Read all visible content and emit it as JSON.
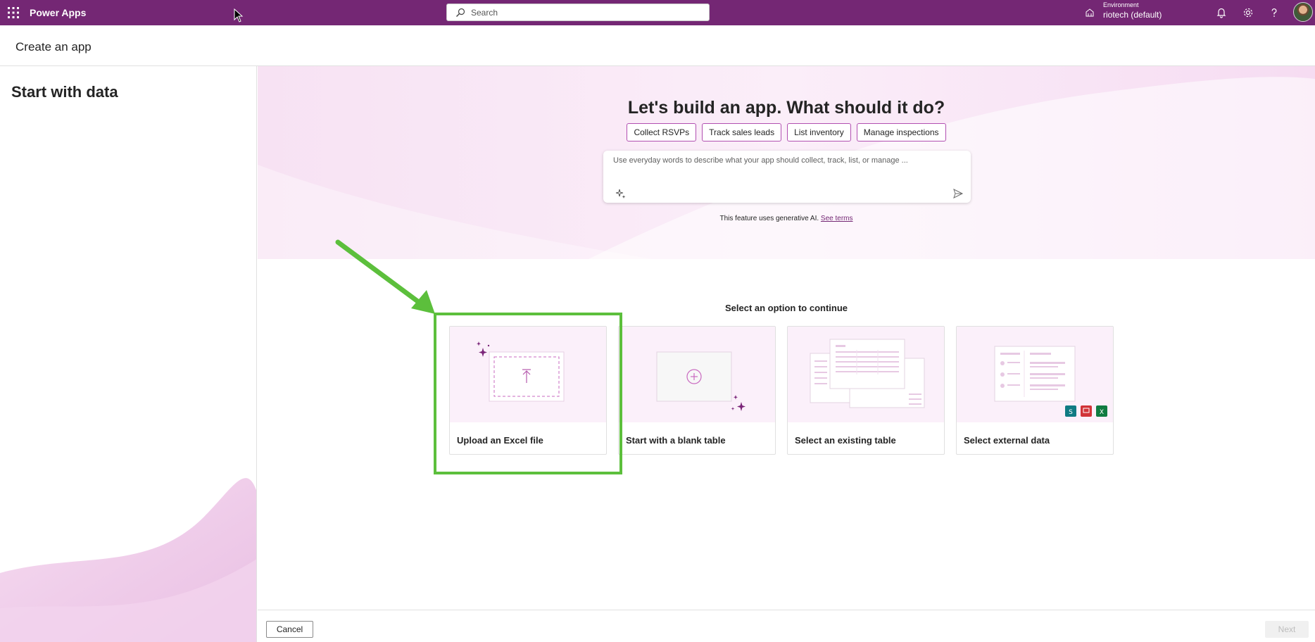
{
  "topbar": {
    "app_name": "Power Apps",
    "search_placeholder": "Search",
    "environment_label": "Environment",
    "environment_name": "riotech (default)",
    "icons": [
      "waffle-icon",
      "environment-icon",
      "bell-icon",
      "gear-icon",
      "help-icon"
    ],
    "brand_color": "#742774"
  },
  "header": {
    "title": "Create an app"
  },
  "left_pane": {
    "heading": "Start with data"
  },
  "hero": {
    "title": "Let's build an app. What should it do?",
    "suggestions": [
      "Collect RSVPs",
      "Track sales leads",
      "List inventory",
      "Manage inspections"
    ],
    "prompt_placeholder": "Use everyday words to describe what your app should collect, track, list, or manage ...",
    "ai_note": "This feature uses generative AI.",
    "see_terms": "See terms"
  },
  "options": {
    "label": "Select an option to continue",
    "cards": [
      {
        "label": "Upload an Excel file",
        "icon": "upload-icon"
      },
      {
        "label": "Start with a blank table",
        "icon": "plus-circle-icon"
      },
      {
        "label": "Select an existing table",
        "icon": "table-icon"
      },
      {
        "label": "Select external data",
        "icon": "external-data-icon"
      }
    ],
    "highlight_color": "#5cbf3c"
  },
  "footer": {
    "cancel_label": "Cancel",
    "next_label": "Next"
  }
}
